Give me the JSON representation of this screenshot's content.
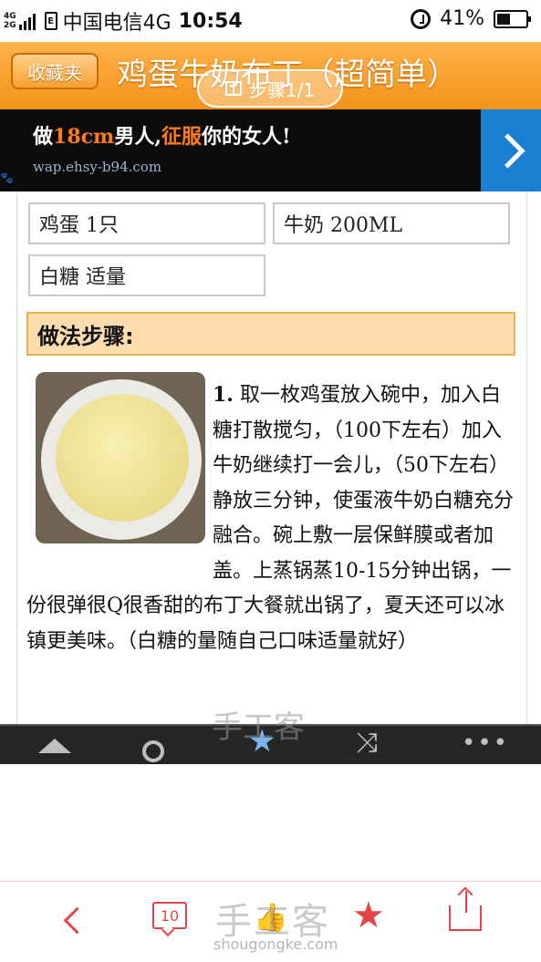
{
  "status_bar": {
    "net_top": "4G",
    "net_bottom": "2G",
    "carrier": "中国电信4G",
    "time": "10:54",
    "battery": "41%"
  },
  "header": {
    "back_label": "收藏夹",
    "title": "鸡蛋牛奶布丁（超简单）",
    "step_indicator": "步骤1/1",
    "accent": "#f39318"
  },
  "ad": {
    "headline_pre": "做",
    "headline_hl1": "18cm",
    "headline_mid1": "男人,",
    "headline_hl2": "征服",
    "headline_end": "你的女人!",
    "url": "wap.ehsy-b94.com"
  },
  "ingredients": [
    {
      "label": "鸡蛋 1只"
    },
    {
      "label": "牛奶 200ML"
    },
    {
      "label": "白糖 适量"
    }
  ],
  "section_title": "做法步骤:",
  "step": {
    "number": "1.",
    "text": " 取一枚鸡蛋放入碗中，加入白糖打散搅匀，（100下左右）加入牛奶继续打一会儿，（50下左右）静放三分钟，使蛋液牛奶白糖充分融合。碗上敷一层保鲜膜或者加盖。上蒸锅蒸10-15分钟出锅，一份很弹很Q很香甜的布丁大餐就出锅了，夏天还可以冰镇更美味。（白糖的量随自己口味适量就好）"
  },
  "watermark_mid": "手工客",
  "bottom_nav": {
    "comment_count": "10",
    "brand": "手工客",
    "brand_url": "shougongke.com",
    "accent": "#e24646"
  }
}
